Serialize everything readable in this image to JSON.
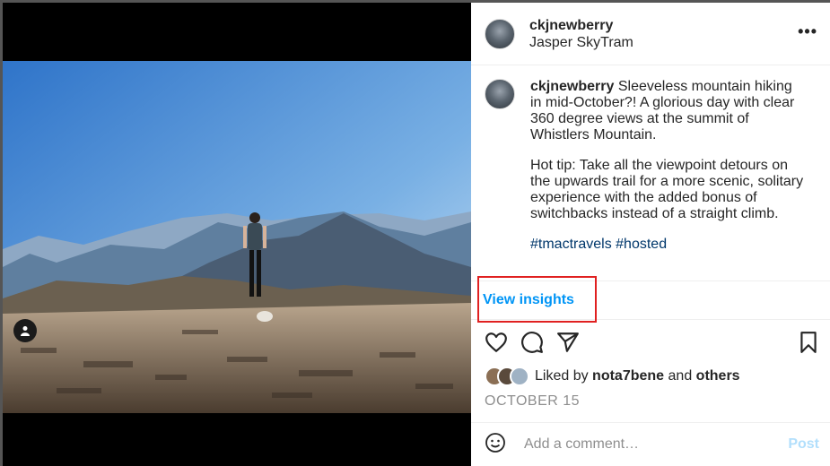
{
  "post": {
    "username": "ckjnewberry",
    "location": "Jasper SkyTram",
    "more_label": "•••",
    "caption_text": "Sleeveless mountain hiking in mid-October?! A glorious day with clear 360 degree views at the summit of Whistlers Mountain.",
    "caption_tip": "Hot tip: Take all the viewpoint detours on the upwards trail for a more scenic, solitary experience with the added bonus of switchbacks instead of a straight climb.",
    "hashtags": [
      "#tmactravels",
      "#hosted"
    ],
    "insights_label": "View insights",
    "likes": {
      "prefix": "Liked by",
      "user": "nota7bene",
      "conjunction": "and",
      "others": "others"
    },
    "date": "OCTOBER 15",
    "comment_placeholder": "Add a comment…",
    "post_label": "Post"
  },
  "icons": [
    "user-tag-icon",
    "heart-icon",
    "comment-icon",
    "share-icon",
    "bookmark-icon",
    "emoji-icon"
  ],
  "colors": {
    "link": "#0095f6",
    "hashtag": "#00376b",
    "highlight": "#e02020",
    "muted": "#8e8e8e"
  }
}
